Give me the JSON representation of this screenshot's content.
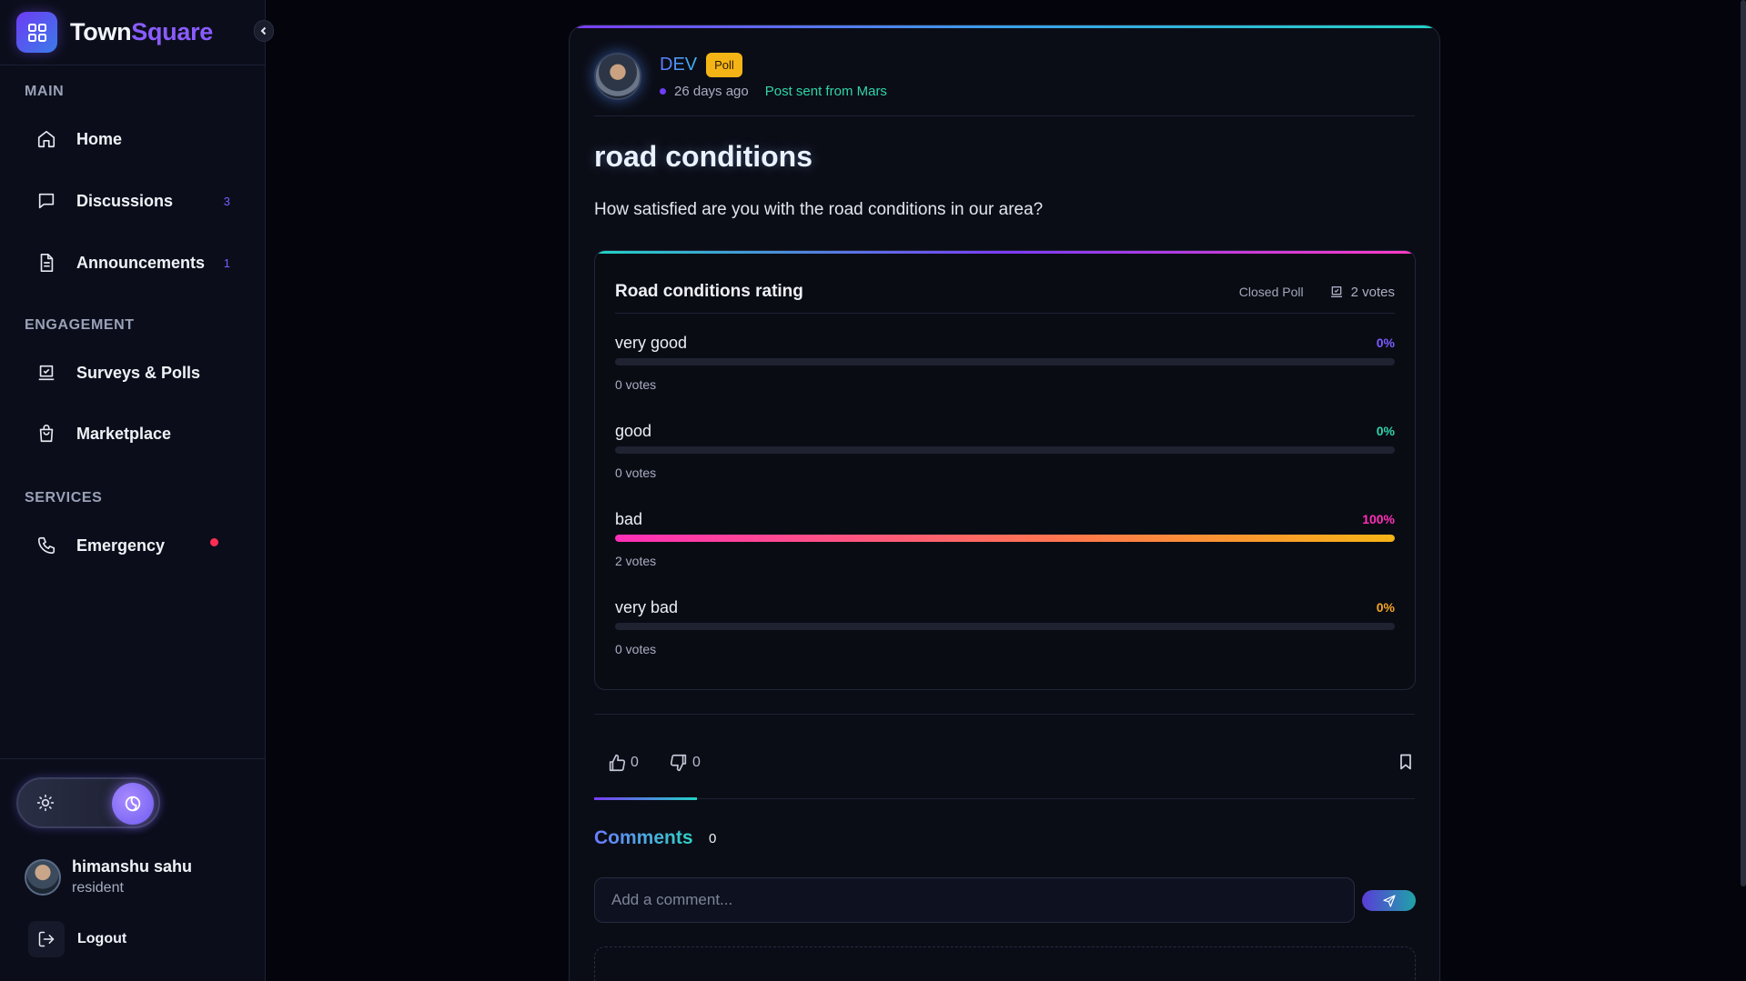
{
  "app": {
    "brand_part1": "Town",
    "brand_part2": "Square"
  },
  "sidebar": {
    "sections": [
      {
        "label": "MAIN"
      },
      {
        "label": "ENGAGEMENT"
      },
      {
        "label": "SERVICES"
      }
    ],
    "items": [
      {
        "label": "Home",
        "icon": "home-icon",
        "badge": ""
      },
      {
        "label": "Discussions",
        "icon": "chat-icon",
        "badge": "3"
      },
      {
        "label": "Announcements",
        "icon": "document-icon",
        "badge": "1"
      },
      {
        "label": "Surveys & Polls",
        "icon": "poll-icon",
        "badge": ""
      },
      {
        "label": "Marketplace",
        "icon": "shopping-bag-icon",
        "badge": ""
      },
      {
        "label": "Emergency",
        "icon": "phone-icon",
        "badge": ""
      }
    ],
    "user": {
      "name": "himanshu sahu",
      "role": "resident"
    },
    "logout_label": "Logout"
  },
  "post": {
    "author": "DEV",
    "type_badge": "Poll",
    "time_ago": "26 days ago",
    "location": "Post sent from Mars",
    "title": "road conditions",
    "body": "How satisfied are you with the road conditions in our area?",
    "poll": {
      "title": "Road conditions rating",
      "status": "Closed Poll",
      "total_votes": "2 votes",
      "options": [
        {
          "label": "very good",
          "percent": 0,
          "percent_text": "0%",
          "votes_text": "0 votes",
          "color": "#7b5cff"
        },
        {
          "label": "good",
          "percent": 0,
          "percent_text": "0%",
          "votes_text": "0 votes",
          "color": "#2fd4a8"
        },
        {
          "label": "bad",
          "percent": 100,
          "percent_text": "100%",
          "votes_text": "2 votes",
          "color": "#ff2fb8"
        },
        {
          "label": "very bad",
          "percent": 0,
          "percent_text": "0%",
          "votes_text": "0 votes",
          "color": "#f5a524"
        }
      ]
    },
    "likes": "0",
    "dislikes": "0",
    "comments_title": "Comments",
    "comments_count": "0",
    "comment_placeholder": "Add a comment..."
  }
}
